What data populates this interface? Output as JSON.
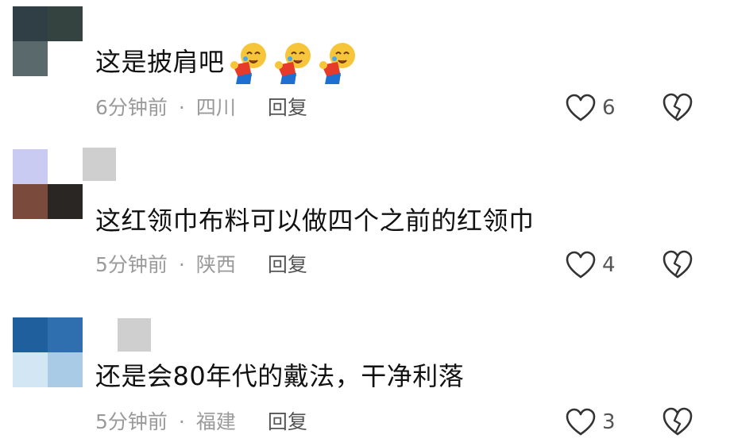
{
  "comments": [
    {
      "text": "这是披肩吧",
      "emoji_icon": "crying-laughing-emoji",
      "time": "6分钟前",
      "separator": "·",
      "location": "四川",
      "reply_label": "回复",
      "like_count": "6"
    },
    {
      "text": "这红领巾布料可以做四个之前的红领巾",
      "time": "5分钟前",
      "separator": "·",
      "location": "陕西",
      "reply_label": "回复",
      "like_count": "4"
    },
    {
      "text": "还是会80年代的戴法，干净利落",
      "time": "5分钟前",
      "separator": "·",
      "location": "福建",
      "reply_label": "回复",
      "like_count": "3"
    }
  ],
  "colors": {
    "text": "#111111",
    "meta": "#9a9a9a",
    "icon_stroke": "#333333"
  }
}
